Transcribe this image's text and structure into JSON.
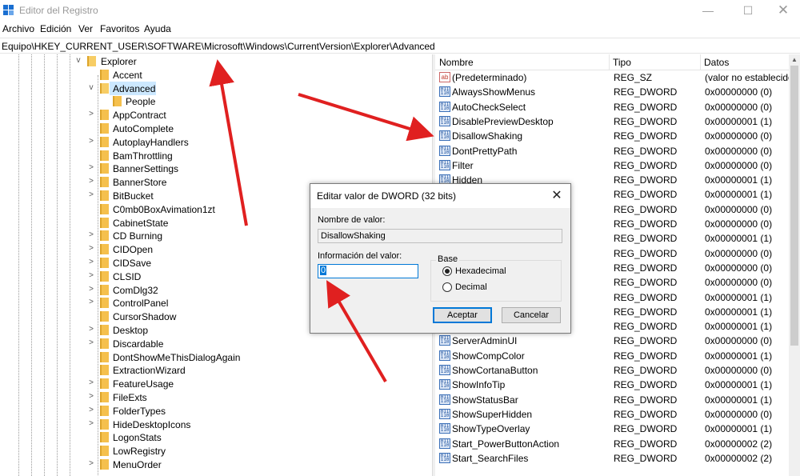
{
  "window": {
    "title": "Editor del Registro",
    "min_glyph": "—",
    "max_glyph": "☐",
    "close_glyph": "✕"
  },
  "menu": [
    "Archivo",
    "Edición",
    "Ver",
    "Favoritos",
    "Ayuda"
  ],
  "address": "Equipo\\HKEY_CURRENT_USER\\SOFTWARE\\Microsoft\\Windows\\CurrentVersion\\Explorer\\Advanced",
  "tree": {
    "root": "Explorer",
    "items": [
      {
        "label": "Accent",
        "depth": 1,
        "chevron": ""
      },
      {
        "label": "Advanced",
        "depth": 1,
        "chevron": "v",
        "selected": true,
        "open": true
      },
      {
        "label": "People",
        "depth": 2,
        "chevron": ""
      },
      {
        "label": "AppContract",
        "depth": 1,
        "chevron": ">"
      },
      {
        "label": "AutoComplete",
        "depth": 1,
        "chevron": ""
      },
      {
        "label": "AutoplayHandlers",
        "depth": 1,
        "chevron": ">"
      },
      {
        "label": "BamThrottling",
        "depth": 1,
        "chevron": ""
      },
      {
        "label": "BannerSettings",
        "depth": 1,
        "chevron": ">"
      },
      {
        "label": "BannerStore",
        "depth": 1,
        "chevron": ">"
      },
      {
        "label": "BitBucket",
        "depth": 1,
        "chevron": ">"
      },
      {
        "label": "C0mb0BoxAvimation1zt",
        "depth": 1,
        "chevron": ""
      },
      {
        "label": "CabinetState",
        "depth": 1,
        "chevron": ""
      },
      {
        "label": "CD Burning",
        "depth": 1,
        "chevron": ">"
      },
      {
        "label": "CIDOpen",
        "depth": 1,
        "chevron": ">"
      },
      {
        "label": "CIDSave",
        "depth": 1,
        "chevron": ">"
      },
      {
        "label": "CLSID",
        "depth": 1,
        "chevron": ">"
      },
      {
        "label": "ComDlg32",
        "depth": 1,
        "chevron": ">"
      },
      {
        "label": "ControlPanel",
        "depth": 1,
        "chevron": ">"
      },
      {
        "label": "CursorShadow",
        "depth": 1,
        "chevron": ""
      },
      {
        "label": "Desktop",
        "depth": 1,
        "chevron": ">"
      },
      {
        "label": "Discardable",
        "depth": 1,
        "chevron": ">"
      },
      {
        "label": "DontShowMeThisDialogAgain",
        "depth": 1,
        "chevron": ""
      },
      {
        "label": "ExtractionWizard",
        "depth": 1,
        "chevron": ""
      },
      {
        "label": "FeatureUsage",
        "depth": 1,
        "chevron": ">"
      },
      {
        "label": "FileExts",
        "depth": 1,
        "chevron": ">"
      },
      {
        "label": "FolderTypes",
        "depth": 1,
        "chevron": ">"
      },
      {
        "label": "HideDesktopIcons",
        "depth": 1,
        "chevron": ">"
      },
      {
        "label": "LogonStats",
        "depth": 1,
        "chevron": ""
      },
      {
        "label": "LowRegistry",
        "depth": 1,
        "chevron": ""
      },
      {
        "label": "MenuOrder",
        "depth": 1,
        "chevron": ">"
      }
    ]
  },
  "list": {
    "columns": {
      "name": "Nombre",
      "type": "Tipo",
      "data": "Datos"
    },
    "rows": [
      {
        "name": "(Predeterminado)",
        "type": "REG_SZ",
        "data": "(valor no establecido",
        "icon": "string"
      },
      {
        "name": "AlwaysShowMenus",
        "type": "REG_DWORD",
        "data": "0x00000000 (0)",
        "icon": "dword"
      },
      {
        "name": "AutoCheckSelect",
        "type": "REG_DWORD",
        "data": "0x00000000 (0)",
        "icon": "dword"
      },
      {
        "name": "DisablePreviewDesktop",
        "type": "REG_DWORD",
        "data": "0x00000001 (1)",
        "icon": "dword"
      },
      {
        "name": "DisallowShaking",
        "type": "REG_DWORD",
        "data": "0x00000000 (0)",
        "icon": "dword"
      },
      {
        "name": "DontPrettyPath",
        "type": "REG_DWORD",
        "data": "0x00000000 (0)",
        "icon": "dword"
      },
      {
        "name": "Filter",
        "type": "REG_DWORD",
        "data": "0x00000000 (0)",
        "icon": "dword"
      },
      {
        "name": "Hidden",
        "type": "REG_DWORD",
        "data": "0x00000001 (1)",
        "icon": "dword"
      },
      {
        "name": "",
        "type": "REG_DWORD",
        "data": "0x00000001 (1)",
        "icon": "dword"
      },
      {
        "name": "",
        "type": "REG_DWORD",
        "data": "0x00000000 (0)",
        "icon": "dword"
      },
      {
        "name": "",
        "type": "REG_DWORD",
        "data": "0x00000000 (0)",
        "icon": "dword"
      },
      {
        "name": "",
        "type": "REG_DWORD",
        "data": "0x00000001 (1)",
        "icon": "dword"
      },
      {
        "name": "",
        "type": "REG_DWORD",
        "data": "0x00000000 (0)",
        "icon": "dword"
      },
      {
        "name": "",
        "type": "REG_DWORD",
        "data": "0x00000000 (0)",
        "icon": "dword"
      },
      {
        "name": "der",
        "type": "REG_DWORD",
        "data": "0x00000000 (0)",
        "icon": "dword"
      },
      {
        "name": "",
        "type": "REG_DWORD",
        "data": "0x00000001 (1)",
        "icon": "dword"
      },
      {
        "name": "",
        "type": "REG_DWORD",
        "data": "0x00000001 (1)",
        "icon": "dword"
      },
      {
        "name": "",
        "type": "REG_DWORD",
        "data": "0x00000001 (1)",
        "icon": "dword"
      },
      {
        "name": "ServerAdminUI",
        "type": "REG_DWORD",
        "data": "0x00000000 (0)",
        "icon": "dword"
      },
      {
        "name": "ShowCompColor",
        "type": "REG_DWORD",
        "data": "0x00000001 (1)",
        "icon": "dword"
      },
      {
        "name": "ShowCortanaButton",
        "type": "REG_DWORD",
        "data": "0x00000000 (0)",
        "icon": "dword"
      },
      {
        "name": "ShowInfoTip",
        "type": "REG_DWORD",
        "data": "0x00000001 (1)",
        "icon": "dword"
      },
      {
        "name": "ShowStatusBar",
        "type": "REG_DWORD",
        "data": "0x00000001 (1)",
        "icon": "dword"
      },
      {
        "name": "ShowSuperHidden",
        "type": "REG_DWORD",
        "data": "0x00000000 (0)",
        "icon": "dword"
      },
      {
        "name": "ShowTypeOverlay",
        "type": "REG_DWORD",
        "data": "0x00000001 (1)",
        "icon": "dword"
      },
      {
        "name": "Start_PowerButtonAction",
        "type": "REG_DWORD",
        "data": "0x00000002 (2)",
        "icon": "dword"
      },
      {
        "name": "Start_SearchFiles",
        "type": "REG_DWORD",
        "data": "0x00000002 (2)",
        "icon": "dword"
      }
    ]
  },
  "dialog": {
    "title": "Editar valor de DWORD (32 bits)",
    "close_glyph": "✕",
    "value_name_label": "Nombre de valor:",
    "value_name": "DisallowShaking",
    "value_data_label": "Información del valor:",
    "value_data": "0",
    "base_label": "Base",
    "hex_label": "Hexadecimal",
    "dec_label": "Decimal",
    "selected_base": "hex",
    "ok_label": "Aceptar",
    "cancel_label": "Cancelar"
  },
  "colors": {
    "selection": "#cce8ff",
    "accent": "#0078d7",
    "folder": "#f5c04d",
    "arrow": "#e02020"
  },
  "icons": {
    "app": "registry-editor-icon",
    "folder": "folder-icon",
    "dword_value": "dword-value-icon",
    "string_value": "string-value-icon"
  }
}
